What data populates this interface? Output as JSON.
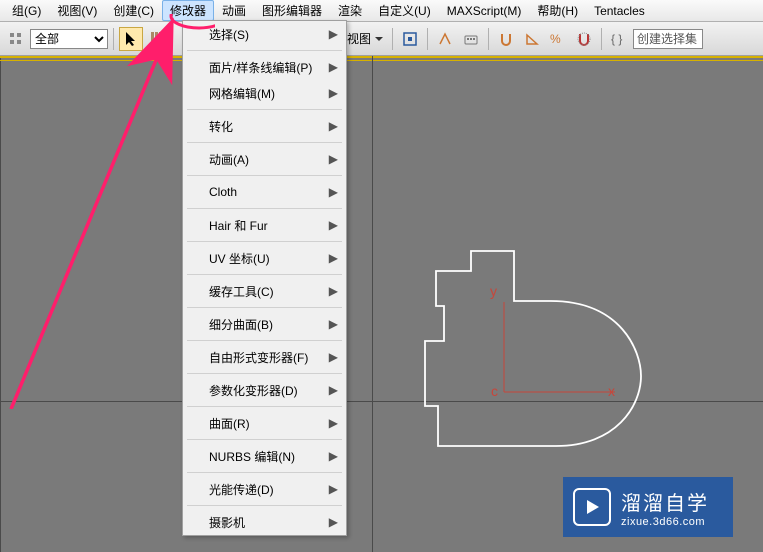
{
  "menubar": {
    "items": [
      "组(G)",
      "视图(V)",
      "创建(C)",
      "修改器",
      "动画",
      "图形编辑器",
      "渲染",
      "自定义(U)",
      "MAXScript(M)",
      "帮助(H)",
      "Tentacles"
    ],
    "activeIndex": 3
  },
  "toolbar": {
    "filter_label": "全部",
    "view_label": "视图",
    "create_selset": "创建选择集"
  },
  "dropdown": {
    "items": [
      {
        "label": "选择(S)",
        "sub": true
      },
      {
        "sep": true
      },
      {
        "label": "面片/样条线编辑(P)",
        "sub": true
      },
      {
        "label": "网格编辑(M)",
        "sub": true
      },
      {
        "sep": true
      },
      {
        "label": "转化",
        "sub": true
      },
      {
        "sep": true
      },
      {
        "label": "动画(A)",
        "sub": true
      },
      {
        "sep": true
      },
      {
        "label": "Cloth",
        "sub": true
      },
      {
        "sep": true
      },
      {
        "label": "Hair 和 Fur",
        "sub": true
      },
      {
        "sep": true
      },
      {
        "label": "UV 坐标(U)",
        "sub": true
      },
      {
        "sep": true
      },
      {
        "label": "缓存工具(C)",
        "sub": true
      },
      {
        "sep": true
      },
      {
        "label": "细分曲面(B)",
        "sub": true
      },
      {
        "sep": true
      },
      {
        "label": "自由形式变形器(F)",
        "sub": true
      },
      {
        "sep": true
      },
      {
        "label": "参数化变形器(D)",
        "sub": true
      },
      {
        "sep": true
      },
      {
        "label": "曲面(R)",
        "sub": true
      },
      {
        "sep": true
      },
      {
        "label": "NURBS 编辑(N)",
        "sub": true
      },
      {
        "sep": true
      },
      {
        "label": "光能传递(D)",
        "sub": true
      },
      {
        "sep": true
      },
      {
        "label": "摄影机",
        "sub": true
      }
    ]
  },
  "axes": {
    "x": "x",
    "y": "y",
    "c": "c"
  },
  "watermark": {
    "line1": "溜溜自学",
    "line2": "zixue.3d66.com"
  }
}
